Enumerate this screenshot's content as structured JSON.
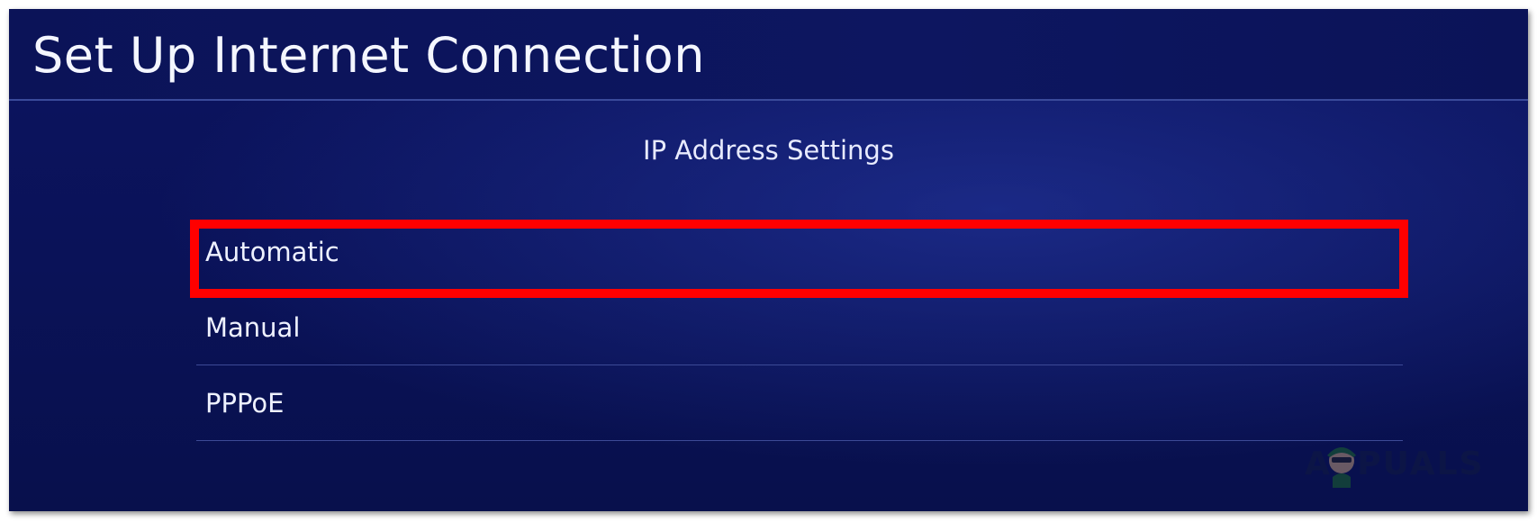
{
  "window": {
    "title": "Set Up Internet Connection"
  },
  "content": {
    "subtitle": "IP Address Settings",
    "options": [
      {
        "label": "Automatic",
        "selected": true
      },
      {
        "label": "Manual",
        "selected": false
      },
      {
        "label": "PPPoE",
        "selected": false
      }
    ]
  },
  "watermark": {
    "text": "APPUALS",
    "icon": "mascot-logo-icon"
  },
  "colors": {
    "background": "#0a1258",
    "highlight": "#ff0000",
    "text": "#eef1ff"
  }
}
